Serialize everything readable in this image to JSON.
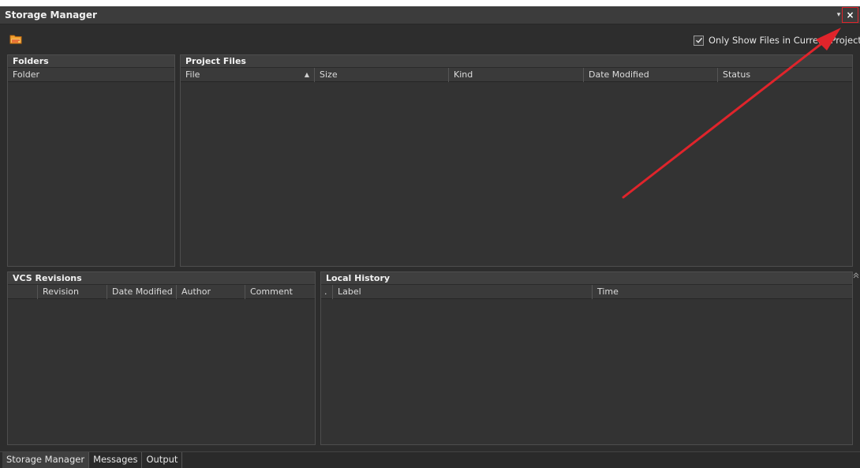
{
  "window": {
    "title": "Storage Manager",
    "dropdown_glyph": "▾",
    "close_glyph": "×"
  },
  "toolbar": {
    "folder_icon": "folder-icon",
    "only_show_label": "Only Show Files in Current Project",
    "only_show_checked": true
  },
  "folders": {
    "title": "Folders",
    "columns": [
      "Folder"
    ]
  },
  "project_files": {
    "title": "Project Files",
    "columns": [
      "File",
      "Size",
      "Kind",
      "Date Modified",
      "Status"
    ],
    "sort_glyph": "▲"
  },
  "vcs": {
    "title": "VCS Revisions",
    "columns": [
      "",
      "Revision",
      "Date Modified",
      "Author",
      "Comment"
    ]
  },
  "history": {
    "title": "Local History",
    "columns": [
      ".",
      "Label",
      "Time"
    ]
  },
  "tabs": [
    "Storage Manager",
    "Messages",
    "Output"
  ],
  "colors": {
    "background": "#2d2d2d",
    "panel": "#333333",
    "highlight": "#e0242b"
  }
}
